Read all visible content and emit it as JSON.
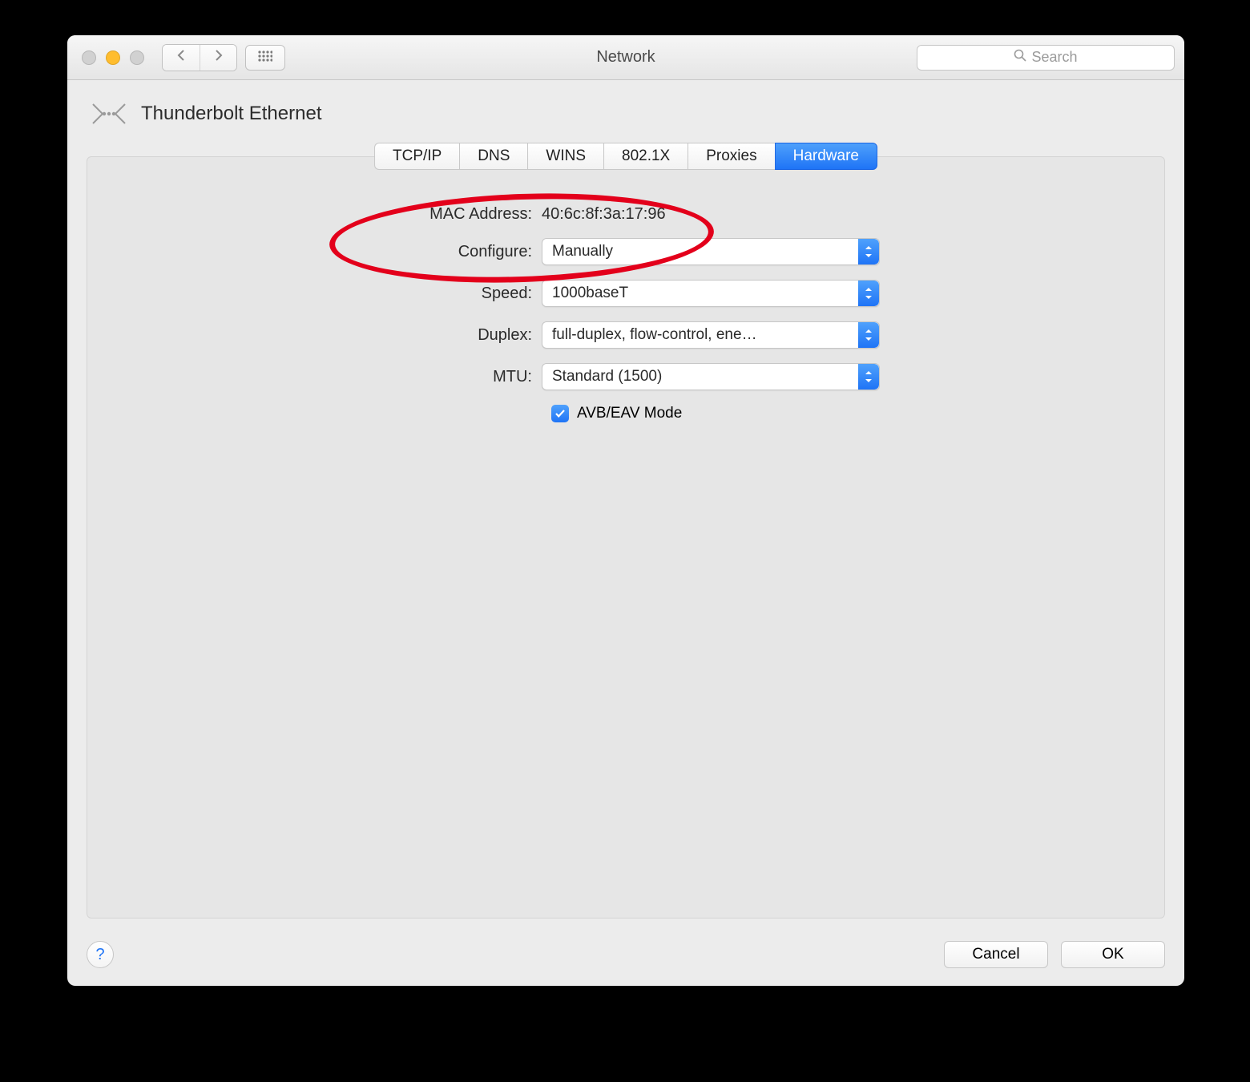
{
  "window": {
    "title": "Network"
  },
  "search": {
    "placeholder": "Search"
  },
  "interface": {
    "name": "Thunderbolt Ethernet"
  },
  "tabs": [
    {
      "label": "TCP/IP",
      "selected": false
    },
    {
      "label": "DNS",
      "selected": false
    },
    {
      "label": "WINS",
      "selected": false
    },
    {
      "label": "802.1X",
      "selected": false
    },
    {
      "label": "Proxies",
      "selected": false
    },
    {
      "label": "Hardware",
      "selected": true
    }
  ],
  "form": {
    "mac_label": "MAC Address:",
    "mac_value": "40:6c:8f:3a:17:96",
    "configure_label": "Configure:",
    "configure_value": "Manually",
    "speed_label": "Speed:",
    "speed_value": "1000baseT",
    "duplex_label": "Duplex:",
    "duplex_value": "full-duplex, flow-control, ene…",
    "mtu_label": "MTU:",
    "mtu_value": "Standard  (1500)",
    "avb_label": "AVB/EAV Mode",
    "avb_checked": true
  },
  "buttons": {
    "cancel": "Cancel",
    "ok": "OK"
  }
}
